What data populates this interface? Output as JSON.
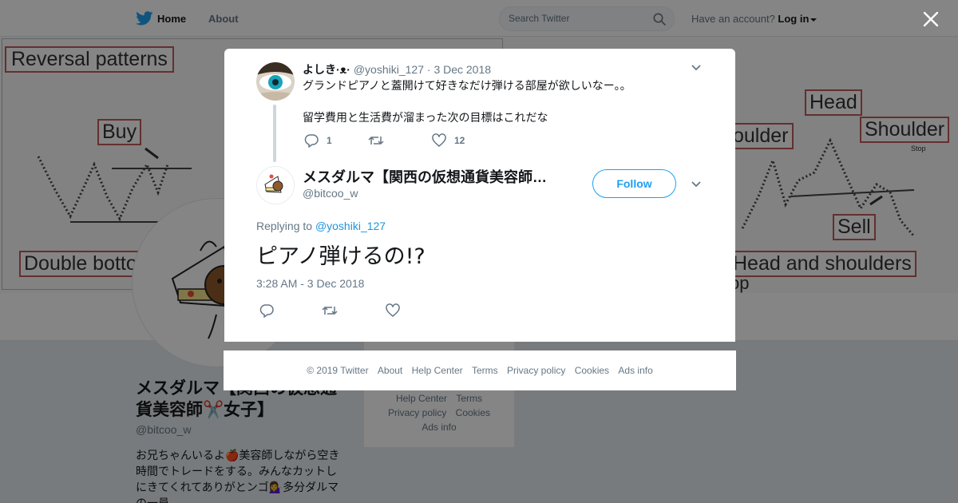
{
  "nav": {
    "home_label": "Home",
    "about_label": "About",
    "search_placeholder": "Search Twitter",
    "account_prompt": "Have an account?",
    "login_label": "Log in"
  },
  "banner": {
    "title": "Reversal patterns",
    "buy": "Buy",
    "double_bottom": "Double botto",
    "head": "Head",
    "shoulder_left": "oulder",
    "shoulder_right": "Shoulder",
    "sell": "Sell",
    "head_shoulders": "Head and shoulders",
    "stop": "op",
    "stop_loss": "Stop"
  },
  "profile": {
    "name": "メスダルマ【関西の仮想通貨美容師✂️女子】",
    "handle": "@bitcoo_w",
    "bio": "お兄ちゃんいるよ🍎美容師しながら空き時間でトレードをする。みんなカットしにきてくれてありがとンゴ💁‍♀️多分ダルマの一員"
  },
  "side_footer": {
    "help_center": "Help Center",
    "terms": "Terms",
    "privacy": "Privacy policy",
    "cookies": "Cookies",
    "ads_info": "Ads info"
  },
  "parent_tweet": {
    "name": "よしき·ᴥ·",
    "handle": "@yoshiki_127",
    "date": "3 Dec 2018",
    "line1": "グランドピアノと蓋開けて好きなだけ弾ける部屋が欲しいなー。。",
    "line2": "留学費用と生活費が溜まった次の目標はこれだな",
    "reply_count": "1",
    "like_count": "12"
  },
  "main_tweet": {
    "name": "メスダルマ【関西の仮想通貨美容師✂️女子】",
    "handle": "@bitcoo_w",
    "follow_label": "Follow",
    "replying_prefix": "Replying to",
    "replying_to": "@yoshiki_127",
    "text": "ピアノ弾けるの!?",
    "timestamp": "3:28 AM - 3 Dec 2018"
  },
  "footer": {
    "copyright": "© 2019 Twitter",
    "about": "About",
    "help_center": "Help Center",
    "terms": "Terms",
    "privacy": "Privacy policy",
    "cookies": "Cookies",
    "ads_info": "Ads info"
  },
  "icons": {
    "bird": "twitter-bird-icon",
    "search": "search-icon",
    "close": "close-icon",
    "reply": "reply-icon",
    "retweet": "retweet-icon",
    "like": "heart-icon",
    "caret": "chevron-down-icon"
  },
  "colors": {
    "brand": "#1da1f2",
    "link": "#1b95e0",
    "muted": "#657786",
    "text": "#14171a"
  }
}
